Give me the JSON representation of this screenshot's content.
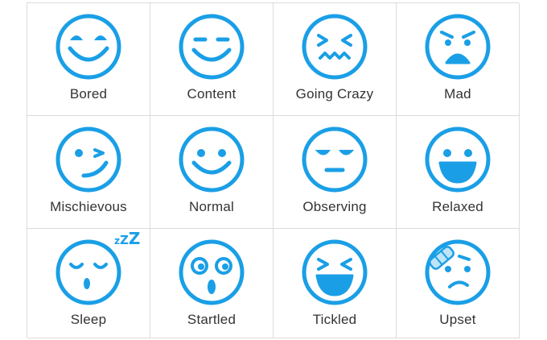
{
  "accent_color": "#1a9fe6",
  "emotions": [
    {
      "label": "Bored",
      "icon": "bored-face-icon"
    },
    {
      "label": "Content",
      "icon": "content-face-icon"
    },
    {
      "label": "Going Crazy",
      "icon": "going-crazy-face-icon"
    },
    {
      "label": "Mad",
      "icon": "mad-face-icon"
    },
    {
      "label": "Mischievous",
      "icon": "mischievous-face-icon"
    },
    {
      "label": "Normal",
      "icon": "normal-face-icon"
    },
    {
      "label": "Observing",
      "icon": "observing-face-icon"
    },
    {
      "label": "Relaxed",
      "icon": "relaxed-face-icon"
    },
    {
      "label": "Sleep",
      "icon": "sleep-face-icon"
    },
    {
      "label": "Startled",
      "icon": "startled-face-icon"
    },
    {
      "label": "Tickled",
      "icon": "tickled-face-icon"
    },
    {
      "label": "Upset",
      "icon": "upset-face-icon"
    }
  ],
  "sleep_zzz": [
    "z",
    "Z",
    "Z"
  ]
}
